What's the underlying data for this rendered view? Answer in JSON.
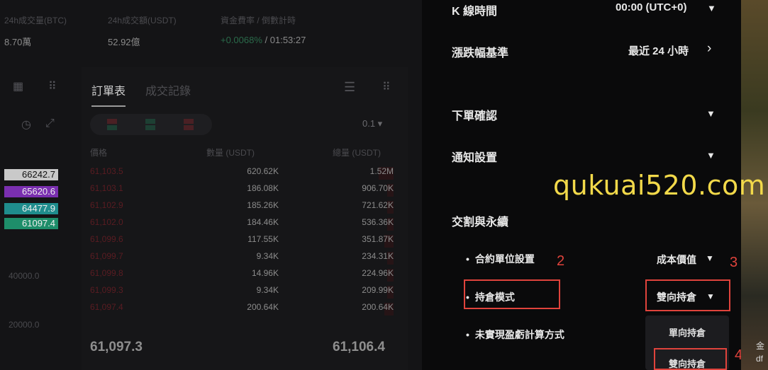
{
  "stats": [
    {
      "label": "24h成交量(BTC)",
      "value": "8.70萬"
    },
    {
      "label": "24h成交額(USDT)",
      "value": "52.92億"
    },
    {
      "label": "資金費率 / 倒數計時",
      "value_rate": "+0.0068%",
      "value_countdown": " / 01:53:27"
    }
  ],
  "orderbook": {
    "tabs": [
      "訂單表",
      "成交記錄"
    ],
    "precision": "0.1 ▾",
    "headers": {
      "price": "價格",
      "amount": "數量 (USDT)",
      "total": "總量 (USDT)"
    },
    "rows": [
      {
        "price": "61,103.5",
        "amount": "620.62K",
        "total": "1.52M"
      },
      {
        "price": "61,103.1",
        "amount": "186.08K",
        "total": "906.70K"
      },
      {
        "price": "61,102.9",
        "amount": "185.26K",
        "total": "721.62K"
      },
      {
        "price": "61,102.0",
        "amount": "184.46K",
        "total": "536.36K"
      },
      {
        "price": "61,099.6",
        "amount": "117.55K",
        "total": "351.87K"
      },
      {
        "price": "61,099.7",
        "amount": "9.34K",
        "total": "234.31K"
      },
      {
        "price": "61,099.8",
        "amount": "14.96K",
        "total": "224.96K"
      },
      {
        "price": "61,099.3",
        "amount": "9.34K",
        "total": "209.99K"
      },
      {
        "price": "61,097.4",
        "amount": "200.64K",
        "total": "200.64K"
      }
    ],
    "last_price": "61,097.3",
    "last_total": "61,106.4"
  },
  "price_tags": [
    {
      "value": "66242.7",
      "bg": "#c9c9c9",
      "fg": "#111111"
    },
    {
      "value": "65620.6",
      "bg": "#7a2fb0",
      "fg": "#eeeeee"
    },
    {
      "value": "64477.9",
      "bg": "#1f8d8d",
      "fg": "#eeeeee"
    },
    {
      "value": "61097.4",
      "bg": "#1e8e6a",
      "fg": "#eeeeee"
    }
  ],
  "axis_labels": [
    "40000.0",
    "20000.0"
  ],
  "settings": {
    "kline_label": "K 線時間",
    "kline_value": "00:00 (UTC+0)",
    "change_label": "漲跌幅基準",
    "change_value": "最近 24 小時",
    "order_confirm_label": "下單確認",
    "notify_label": "通知設置",
    "section_label": "交割與永續",
    "contract_unit_label": "合約單位設置",
    "contract_unit_value": "成本價值",
    "position_mode_label": "持倉模式",
    "position_mode_value": "雙向持倉",
    "pnl_label": "未實現盈虧計算方式",
    "dropdown_options": [
      "單向持倉",
      "雙向持倉"
    ]
  },
  "annotations": [
    "2",
    "3",
    "4"
  ],
  "watermark": "qukuai520.com",
  "edge_text": [
    "金",
    "df"
  ],
  "colors": {
    "annotation": "#e0433c",
    "watermark": "#f2d94a"
  }
}
